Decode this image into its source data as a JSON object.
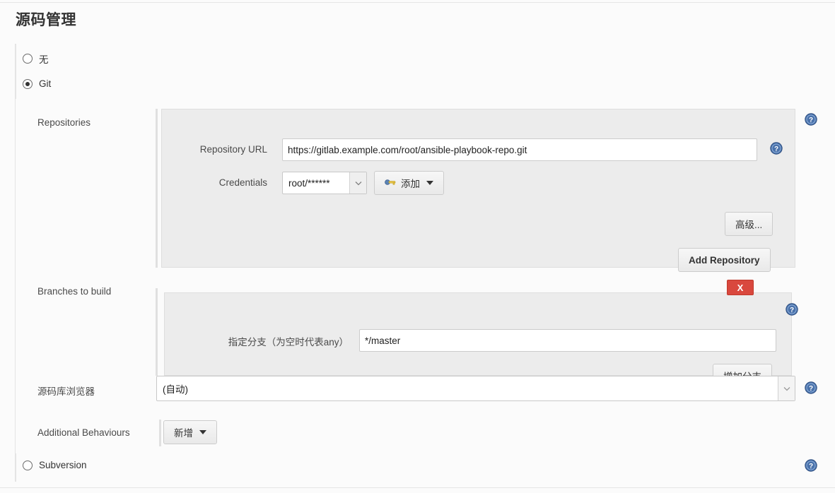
{
  "page": {
    "title": "源码管理"
  },
  "scm_options": [
    {
      "label": "无",
      "selected": false
    },
    {
      "label": "Git",
      "selected": true
    },
    {
      "label": "Subversion",
      "selected": false
    }
  ],
  "git": {
    "repositories": {
      "label": "Repositories",
      "repository_url": {
        "label": "Repository URL",
        "value": "https://gitlab.example.com/root/ansible-playbook-repo.git",
        "placeholder": ""
      },
      "credentials": {
        "label": "Credentials",
        "value": "root/******",
        "add_button": "添加",
        "add_button_icon": "key-icon"
      },
      "advanced_button": "高级...",
      "add_repository_button": "Add Repository"
    },
    "branches": {
      "label": "Branches to build",
      "branch_specifier": {
        "label": "指定分支（为空时代表any）",
        "value": "*/master",
        "placeholder": ""
      },
      "delete_button": "X",
      "add_branch_button": "增加分支"
    },
    "repository_browser": {
      "label": "源码库浏览器",
      "value": "(自动)"
    },
    "additional_behaviours": {
      "label": "Additional Behaviours",
      "add_button": "新增"
    }
  },
  "colors": {
    "help_icon": "#4a72ab",
    "delete_button": "#d9483e",
    "panel_bg": "#ececec",
    "page_bg": "#fbfbfb"
  }
}
